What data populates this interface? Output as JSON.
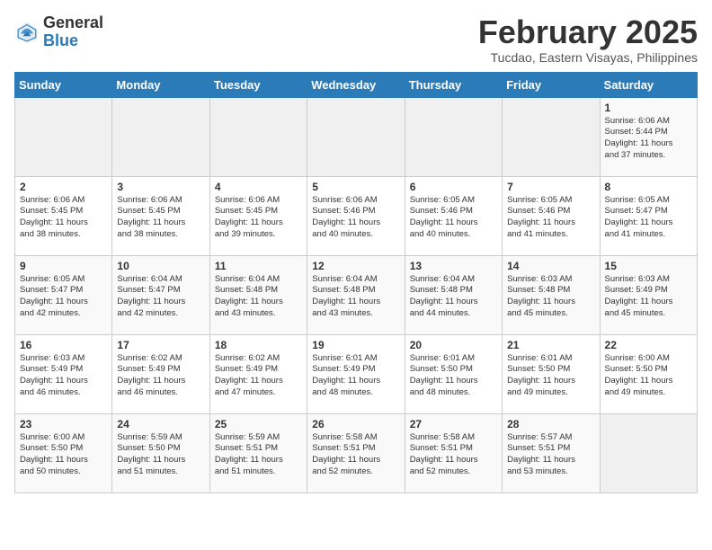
{
  "header": {
    "logo_general": "General",
    "logo_blue": "Blue",
    "month_year": "February 2025",
    "location": "Tucdao, Eastern Visayas, Philippines"
  },
  "calendar": {
    "headers": [
      "Sunday",
      "Monday",
      "Tuesday",
      "Wednesday",
      "Thursday",
      "Friday",
      "Saturday"
    ],
    "weeks": [
      [
        {
          "day": "",
          "info": ""
        },
        {
          "day": "",
          "info": ""
        },
        {
          "day": "",
          "info": ""
        },
        {
          "day": "",
          "info": ""
        },
        {
          "day": "",
          "info": ""
        },
        {
          "day": "",
          "info": ""
        },
        {
          "day": "1",
          "info": "Sunrise: 6:06 AM\nSunset: 5:44 PM\nDaylight: 11 hours\nand 37 minutes."
        }
      ],
      [
        {
          "day": "2",
          "info": "Sunrise: 6:06 AM\nSunset: 5:45 PM\nDaylight: 11 hours\nand 38 minutes."
        },
        {
          "day": "3",
          "info": "Sunrise: 6:06 AM\nSunset: 5:45 PM\nDaylight: 11 hours\nand 38 minutes."
        },
        {
          "day": "4",
          "info": "Sunrise: 6:06 AM\nSunset: 5:45 PM\nDaylight: 11 hours\nand 39 minutes."
        },
        {
          "day": "5",
          "info": "Sunrise: 6:06 AM\nSunset: 5:46 PM\nDaylight: 11 hours\nand 40 minutes."
        },
        {
          "day": "6",
          "info": "Sunrise: 6:05 AM\nSunset: 5:46 PM\nDaylight: 11 hours\nand 40 minutes."
        },
        {
          "day": "7",
          "info": "Sunrise: 6:05 AM\nSunset: 5:46 PM\nDaylight: 11 hours\nand 41 minutes."
        },
        {
          "day": "8",
          "info": "Sunrise: 6:05 AM\nSunset: 5:47 PM\nDaylight: 11 hours\nand 41 minutes."
        }
      ],
      [
        {
          "day": "9",
          "info": "Sunrise: 6:05 AM\nSunset: 5:47 PM\nDaylight: 11 hours\nand 42 minutes."
        },
        {
          "day": "10",
          "info": "Sunrise: 6:04 AM\nSunset: 5:47 PM\nDaylight: 11 hours\nand 42 minutes."
        },
        {
          "day": "11",
          "info": "Sunrise: 6:04 AM\nSunset: 5:48 PM\nDaylight: 11 hours\nand 43 minutes."
        },
        {
          "day": "12",
          "info": "Sunrise: 6:04 AM\nSunset: 5:48 PM\nDaylight: 11 hours\nand 43 minutes."
        },
        {
          "day": "13",
          "info": "Sunrise: 6:04 AM\nSunset: 5:48 PM\nDaylight: 11 hours\nand 44 minutes."
        },
        {
          "day": "14",
          "info": "Sunrise: 6:03 AM\nSunset: 5:48 PM\nDaylight: 11 hours\nand 45 minutes."
        },
        {
          "day": "15",
          "info": "Sunrise: 6:03 AM\nSunset: 5:49 PM\nDaylight: 11 hours\nand 45 minutes."
        }
      ],
      [
        {
          "day": "16",
          "info": "Sunrise: 6:03 AM\nSunset: 5:49 PM\nDaylight: 11 hours\nand 46 minutes."
        },
        {
          "day": "17",
          "info": "Sunrise: 6:02 AM\nSunset: 5:49 PM\nDaylight: 11 hours\nand 46 minutes."
        },
        {
          "day": "18",
          "info": "Sunrise: 6:02 AM\nSunset: 5:49 PM\nDaylight: 11 hours\nand 47 minutes."
        },
        {
          "day": "19",
          "info": "Sunrise: 6:01 AM\nSunset: 5:49 PM\nDaylight: 11 hours\nand 48 minutes."
        },
        {
          "day": "20",
          "info": "Sunrise: 6:01 AM\nSunset: 5:50 PM\nDaylight: 11 hours\nand 48 minutes."
        },
        {
          "day": "21",
          "info": "Sunrise: 6:01 AM\nSunset: 5:50 PM\nDaylight: 11 hours\nand 49 minutes."
        },
        {
          "day": "22",
          "info": "Sunrise: 6:00 AM\nSunset: 5:50 PM\nDaylight: 11 hours\nand 49 minutes."
        }
      ],
      [
        {
          "day": "23",
          "info": "Sunrise: 6:00 AM\nSunset: 5:50 PM\nDaylight: 11 hours\nand 50 minutes."
        },
        {
          "day": "24",
          "info": "Sunrise: 5:59 AM\nSunset: 5:50 PM\nDaylight: 11 hours\nand 51 minutes."
        },
        {
          "day": "25",
          "info": "Sunrise: 5:59 AM\nSunset: 5:51 PM\nDaylight: 11 hours\nand 51 minutes."
        },
        {
          "day": "26",
          "info": "Sunrise: 5:58 AM\nSunset: 5:51 PM\nDaylight: 11 hours\nand 52 minutes."
        },
        {
          "day": "27",
          "info": "Sunrise: 5:58 AM\nSunset: 5:51 PM\nDaylight: 11 hours\nand 52 minutes."
        },
        {
          "day": "28",
          "info": "Sunrise: 5:57 AM\nSunset: 5:51 PM\nDaylight: 11 hours\nand 53 minutes."
        },
        {
          "day": "",
          "info": ""
        }
      ]
    ]
  }
}
